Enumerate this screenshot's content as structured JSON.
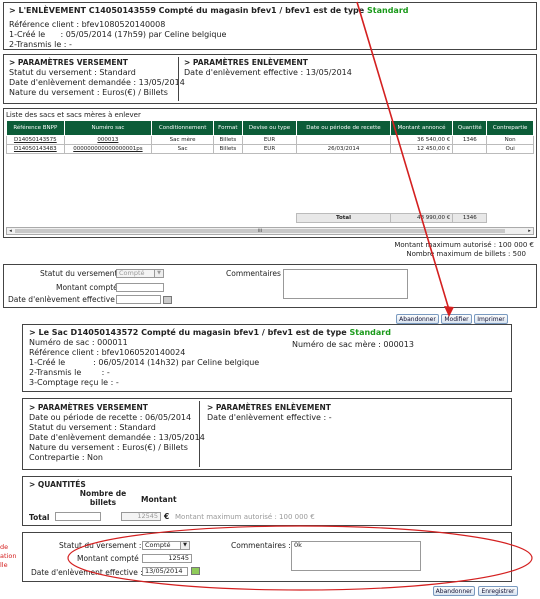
{
  "top": {
    "title_prefix": "> L'ENLÈVEMENT C14050143559 Compté du magasin bfev1 / bfev1 est de type",
    "title_type": "Standard",
    "ref_client": "Référence client : bfev1080520140008",
    "cree": "1-Créé le      : 05/05/2014 (17h59) par Celine belgique",
    "transmis": "2-Transmis le : -"
  },
  "versement": {
    "title": "> PARAMÈTRES VERSEMENT",
    "statut": "Statut du versement : Standard",
    "date_demandee": "Date d'enlèvement demandée : 13/05/2014",
    "nature": "Nature du versement : Euros(€) / Billets"
  },
  "enlevement": {
    "title": "> PARAMÈTRES ENLÈVEMENT",
    "date_effective": "Date d'enlèvement effective : 13/05/2014"
  },
  "sacs": {
    "title": "Liste des sacs et sacs mères à enlever",
    "headers": [
      "Référence BNPP",
      "Numéro sac",
      "Conditionnement",
      "Format",
      "Devise ou type",
      "Date ou période de recette",
      "Montant annoncé",
      "Quantité",
      "Contrepartie"
    ],
    "rows": [
      [
        "D14050143575",
        "000013",
        "Sac mère",
        "Billets",
        "EUR",
        "",
        "36 540,00 €",
        "1346",
        "Non"
      ],
      [
        "D14050143483",
        "000000000000000001ps",
        "Sac",
        "Billets",
        "EUR",
        "26/03/2014",
        "12 450,00 €",
        "",
        "Oui"
      ]
    ],
    "total_label": "Total",
    "total_montant": "48 990,00 €",
    "total_quantite": "1346",
    "scroll_mark": "III"
  },
  "max_montant": "Montant maximum autorisé : 100 000 €",
  "max_billets": "Nombre maximum de billets : 500",
  "form1": {
    "statut_label": "Statut du versement :",
    "statut_value": "Compté",
    "montant_label": "Montant compté :",
    "date_label": "Date d'enlèvement effective :",
    "comment_label": "Commentaires :"
  },
  "buttons1": {
    "abandon": "Abandonner",
    "modifier": "Modifier",
    "imprimer": "Imprimer"
  },
  "sac": {
    "title_prefix": "> Le Sac D14050143572 Compté du magasin bfev1 / bfev1 est de type",
    "title_type": "Standard",
    "numero": "Numéro de sac : 000011",
    "numero_mere": "Numéro de sac mère : 000013",
    "ref": "Référence client : bfev1060520140024",
    "cree": "1-Créé le           : 06/05/2014 (14h32) par Celine belgique",
    "transmis": "2-Transmis le        : -",
    "comptage": "3-Comptage reçu le : -"
  },
  "versement2": {
    "title": "> PARAMÈTRES VERSEMENT",
    "date_periode": "Date ou période de recette : 06/05/2014",
    "statut": "Statut du versement : Standard",
    "date_demandee": "Date d'enlèvement demandée : 13/05/2014",
    "nature": "Nature du versement : Euros(€) / Billets",
    "contrepartie": "Contrepartie : Non"
  },
  "enlevement2": {
    "title": "> PARAMÈTRES ENLÈVEMENT",
    "date_effective": "Date d'enlèvement effective : -"
  },
  "quantites": {
    "title": "> QUANTITÉS",
    "col_billets": "Nombre de billets",
    "col_montant": "Montant",
    "total_label": "Total",
    "montant_value": "12545",
    "currency": "€",
    "max_text": "Montant maximum autorisé : 100 000 €"
  },
  "form2": {
    "statut_label": "Statut du versement :",
    "statut_value": "Compté",
    "montant_label": "Montant compté :",
    "montant_value": "12545",
    "date_label": "Date d'enlèvement effective :",
    "date_value": "13/05/2014",
    "comment_label": "Commentaires :",
    "comment_value": "0k"
  },
  "buttons2": {
    "abandon": "Abandonner",
    "enregistrer": "Enregistrer"
  },
  "annotation": {
    "lines": [
      "de",
      "ation",
      "lle"
    ]
  },
  "colors": {
    "accent": "#1a9a1a",
    "table_header": "#0c5c38",
    "annotation": "#d42020"
  }
}
